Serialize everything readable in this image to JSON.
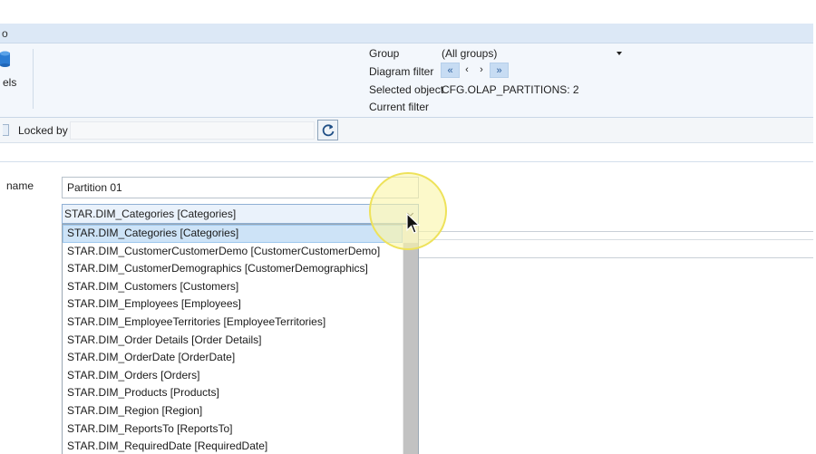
{
  "window": {
    "title_fragment": "o"
  },
  "ribbon": {
    "models_label": "els",
    "group_label": "Group",
    "group_value": "(All groups)",
    "diagram_filter_label": "Diagram filter",
    "nav": {
      "first": "«",
      "prev": "‹",
      "next": "›",
      "last": "»"
    },
    "selected_object_label": "Selected object",
    "selected_object_value": "CFG.OLAP_PARTITIONS: 2",
    "current_filter_label": "Current filter",
    "current_filter_value": ""
  },
  "lockbar": {
    "locked_by_label": "Locked by",
    "locked_by_value": ""
  },
  "form": {
    "name_label": "name",
    "name_value": "Partition 01",
    "dimension_value": "STAR.DIM_Categories [Categories]"
  },
  "dropdown": {
    "items": [
      "STAR.DIM_Categories [Categories]",
      "STAR.DIM_CustomerCustomerDemo [CustomerCustomerDemo]",
      "STAR.DIM_CustomerDemographics [CustomerDemographics]",
      "STAR.DIM_Customers [Customers]",
      "STAR.DIM_Employees [Employees]",
      "STAR.DIM_EmployeeTerritories [EmployeeTerritories]",
      "STAR.DIM_Order Details [Order Details]",
      "STAR.DIM_OrderDate [OrderDate]",
      "STAR.DIM_Orders [Orders]",
      "STAR.DIM_Products [Products]",
      "STAR.DIM_Region [Region]",
      "STAR.DIM_ReportsTo [ReportsTo]",
      "STAR.DIM_RequiredDate [RequiredDate]"
    ],
    "selected_index": 0
  },
  "colors": {
    "titlebar": "#dce8f6",
    "ribbon": "#f3f7fc",
    "selection": "#cde3f7",
    "cursor_halo": "#faf6aa"
  }
}
